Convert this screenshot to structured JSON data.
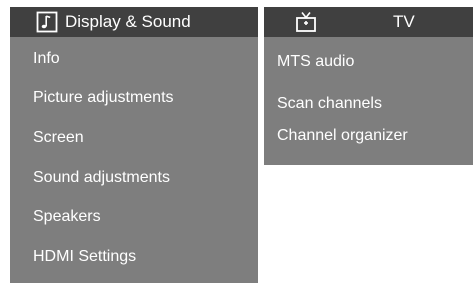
{
  "display_menu": {
    "title": "Display & Sound",
    "icon": "music-note-icon",
    "items": [
      {
        "label": "Info"
      },
      {
        "label": "Picture adjustments"
      },
      {
        "label": "Screen"
      },
      {
        "label": "Sound adjustments"
      },
      {
        "label": "Speakers"
      },
      {
        "label": "HDMI Settings"
      }
    ]
  },
  "tv_menu": {
    "title": "TV",
    "icon": "tv-icon",
    "items": [
      {
        "label": "MTS audio"
      },
      {
        "label": "Scan channels"
      },
      {
        "label": "Channel organizer"
      }
    ]
  },
  "colors": {
    "header_bg": "#404040",
    "menu_bg": "#7e7e7e",
    "text": "#ffffff"
  }
}
